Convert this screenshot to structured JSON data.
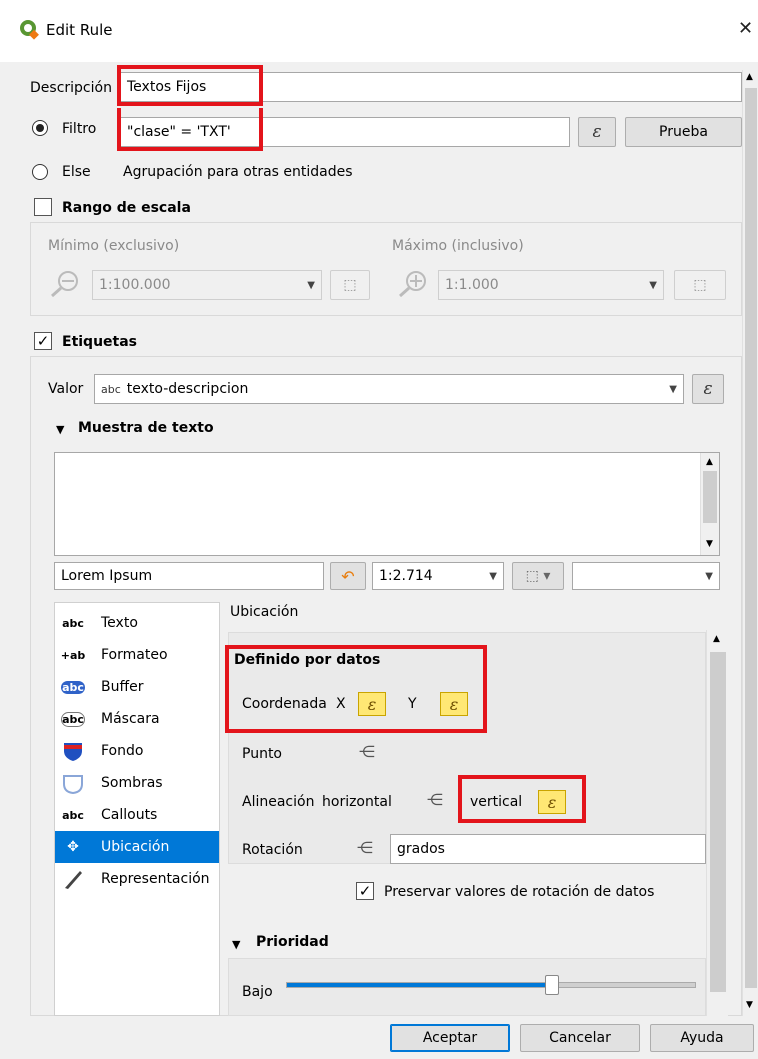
{
  "window": {
    "title": "Edit Rule",
    "close_glyph": "✕"
  },
  "description": {
    "label": "Descripción",
    "value": "Textos Fijos"
  },
  "filter": {
    "label": "Filtro",
    "value": "\"clase\"  =  'TXT'",
    "expression_icon": "ε",
    "test_button": "Prueba"
  },
  "else": {
    "label": "Else",
    "text": "Agrupación para otras entidades"
  },
  "scale": {
    "title": "Rango de escala",
    "min_label": "Mínimo (exclusivo)",
    "max_label": "Máximo (inclusivo)",
    "min_value": "1:100.000",
    "max_value": "1:1.000"
  },
  "labels": {
    "title": "Etiquetas",
    "checked": true,
    "value_label": "Valor",
    "value_prefix": "abc",
    "value": "texto-descripcion",
    "expression_icon": "ε"
  },
  "sample": {
    "title": "Muestra de texto",
    "sample_text": "Lorem Ipsum",
    "scale": "1:2.714"
  },
  "sidebar": {
    "items": [
      {
        "label": "Texto",
        "icon": "abc"
      },
      {
        "label": "Formateo",
        "icon": "+ab"
      },
      {
        "label": "Buffer",
        "icon": "abc"
      },
      {
        "label": "Máscara",
        "icon": "abc"
      },
      {
        "label": "Fondo",
        "icon": "shield"
      },
      {
        "label": "Sombras",
        "icon": "cloud"
      },
      {
        "label": "Callouts",
        "icon": "abc"
      },
      {
        "label": "Ubicación",
        "icon": "move"
      },
      {
        "label": "Representación",
        "icon": "brush"
      }
    ],
    "selected": 7
  },
  "placement": {
    "title": "Ubicación",
    "data_defined_title": "Definido por datos",
    "coord_label": "Coordenada",
    "x_label": "X",
    "y_label": "Y",
    "point_label": "Punto",
    "alignment_label": "Alineación",
    "horizontal_label": "horizontal",
    "vertical_label": "vertical",
    "rotation_label": "Rotación",
    "rotation_unit": "grados",
    "preserve_label": "Preservar valores de rotación de datos",
    "priority_title": "Prioridad",
    "low_label": "Bajo",
    "priority_level": 0.65
  },
  "footer": {
    "accept": "Aceptar",
    "cancel": "Cancelar",
    "help": "Ayuda"
  },
  "colors": {
    "accent": "#0078d7",
    "highlight": "#e3141b",
    "expr_active": "#ffe874"
  }
}
